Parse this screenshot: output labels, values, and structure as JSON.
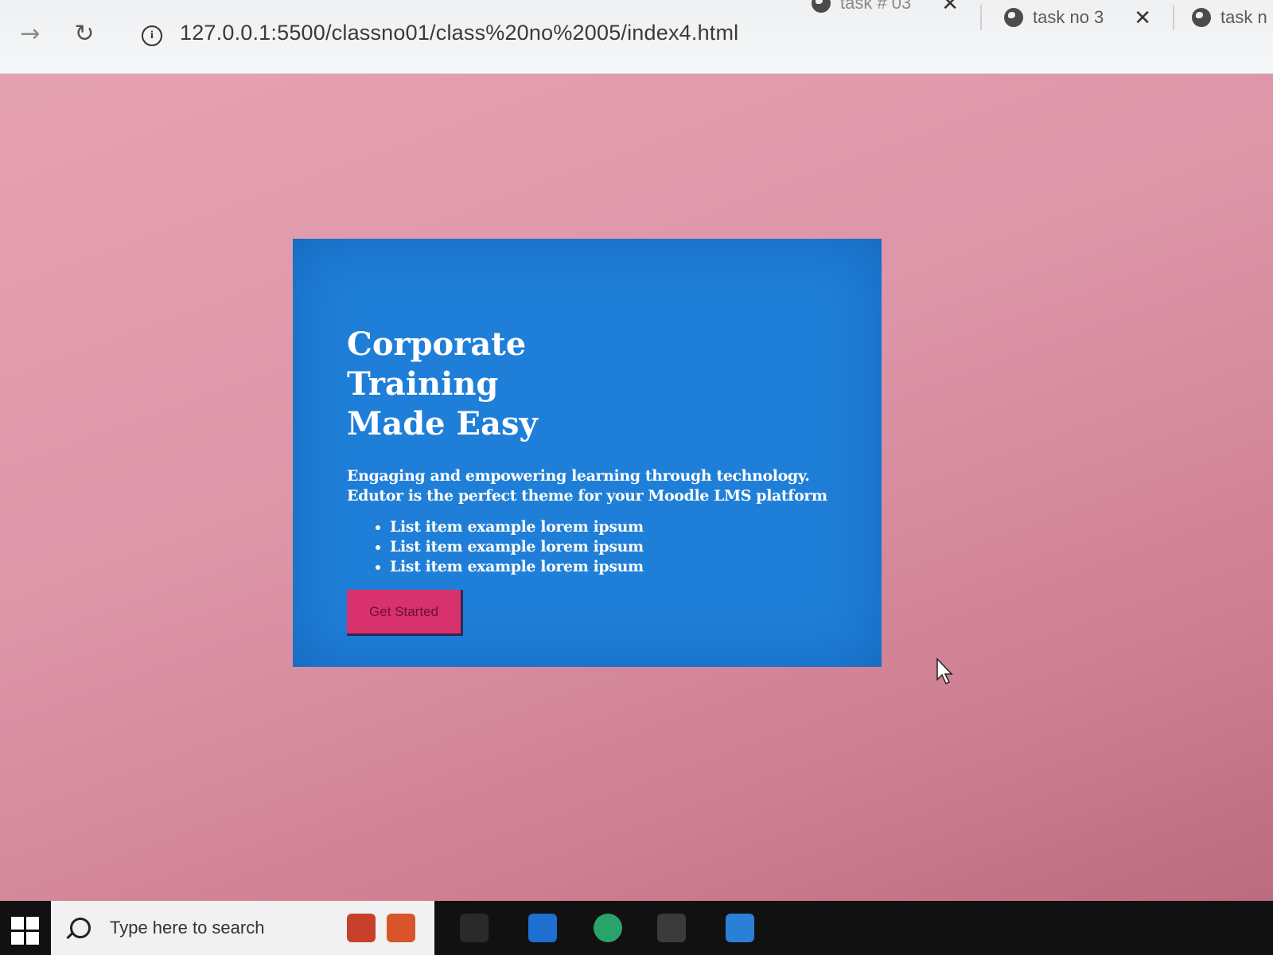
{
  "browser": {
    "tabs": [
      {
        "label": "task # 03"
      },
      {
        "label": "task no 3"
      },
      {
        "label": "task n"
      }
    ],
    "url": "127.0.0.1:5500/classno01/class%20no%2005/index4.html"
  },
  "hero": {
    "title_line1": "Corporate Training",
    "title_line2": "Made Easy",
    "desc_line1": "Engaging and empowering learning through technology.",
    "desc_line2": "Edutor is the perfect theme for your Moodle LMS platform",
    "list": [
      "List item example lorem ipsum",
      "List item example lorem ipsum",
      "List item example lorem ipsum"
    ],
    "cta_label": "Get Started"
  },
  "taskbar": {
    "search_placeholder": "Type here to search"
  },
  "colors": {
    "page_bg": "#dd95a8",
    "hero_bg": "#1f7fd8",
    "cta_bg": "#d8316c"
  },
  "icons": [
    "forward-arrow-icon",
    "reload-icon",
    "info-icon",
    "globe-icon",
    "close-icon",
    "windows-logo-icon",
    "search-icon",
    "mouse-cursor-icon"
  ]
}
